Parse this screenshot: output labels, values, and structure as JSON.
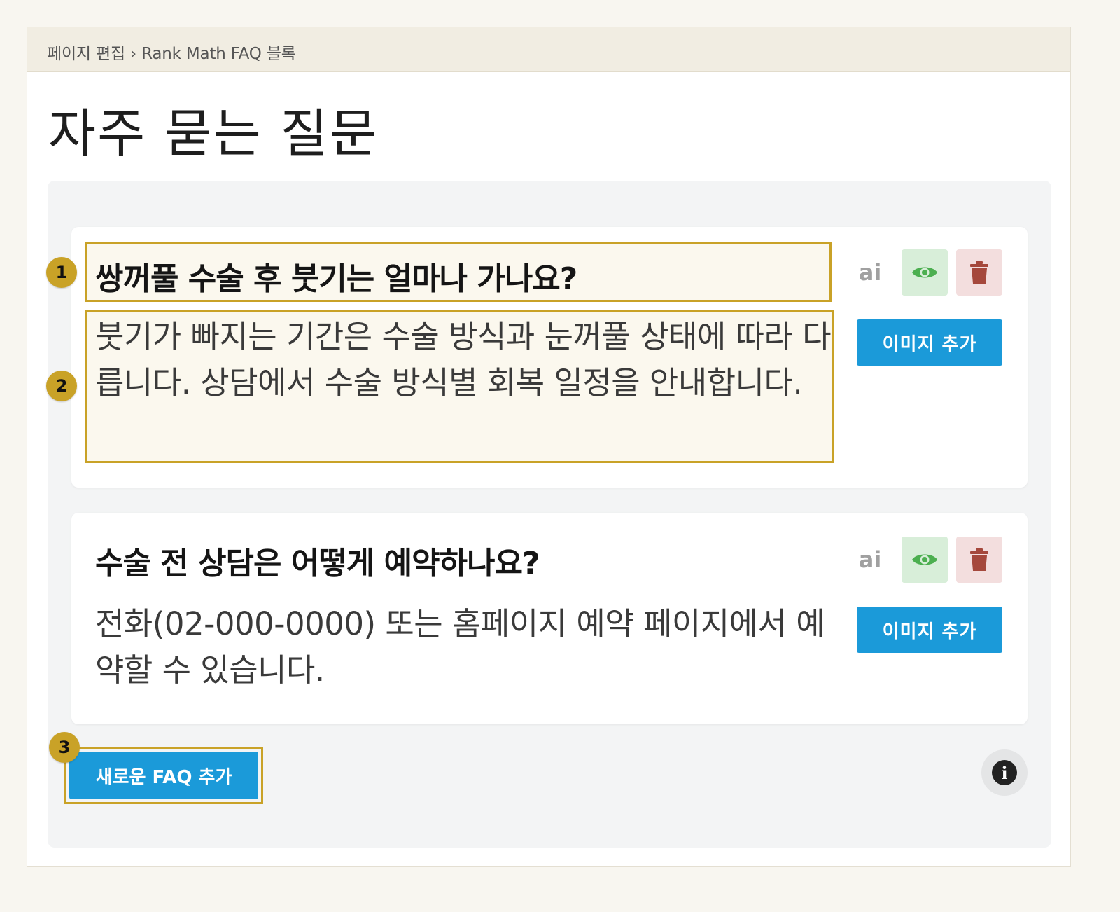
{
  "breadcrumb": "페이지 편집 › Rank Math FAQ 블록",
  "page_title": "자주 묻는 질문",
  "faqs": [
    {
      "question": "쌍꺼풀 수술 후 붓기는 얼마나 가나요?",
      "answer": "붓기가 빠지는 기간은 수술 방식과 눈꺼풀 상태에 따라 다릅니다. 상담에서 수술 방식별 회복 일정을 안내합니다.",
      "ai_icon": "ai",
      "image_button": "이미지 추가"
    },
    {
      "question": "수술 전 상담은 어떻게 예약하나요?",
      "answer": "전화(02-000-0000) 또는 홈페이지 예약 페이지에서 예약할 수 있습니다.",
      "ai_icon": "ai",
      "image_button": "이미지 추가"
    }
  ],
  "add_faq_button": "새로운 FAQ 추가",
  "info_icon": "i",
  "badges": [
    "1",
    "2",
    "3"
  ],
  "colors": {
    "accent_blue": "#1b9ad9",
    "highlight_gold": "#c9a227",
    "eye_green": "#4caf50",
    "trash_red": "#a5483c"
  }
}
